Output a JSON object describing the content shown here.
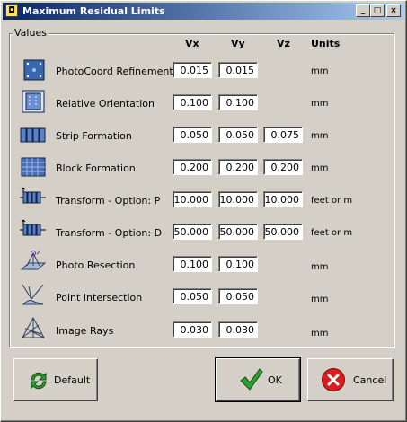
{
  "window": {
    "title": "Maximum Residual Limits"
  },
  "group": {
    "label": "Values"
  },
  "headers": {
    "vx": "Vx",
    "vy": "Vy",
    "vz": "Vz",
    "units": "Units"
  },
  "rows": [
    {
      "label": "PhotoCoord Refinement",
      "icon": "photocoord-icon",
      "vx": "0.015",
      "vy": "0.015",
      "vz": null,
      "unit": "mm"
    },
    {
      "label": "Relative Orientation",
      "icon": "relative-orientation-icon",
      "vx": "0.100",
      "vy": "0.100",
      "vz": null,
      "unit": "mm"
    },
    {
      "label": "Strip Formation",
      "icon": "strip-formation-icon",
      "vx": "0.050",
      "vy": "0.050",
      "vz": "0.075",
      "unit": "mm"
    },
    {
      "label": "Block Formation",
      "icon": "block-formation-icon",
      "vx": "0.200",
      "vy": "0.200",
      "vz": "0.200",
      "unit": "mm"
    },
    {
      "label": "Transform - Option: P",
      "icon": "transform-p-icon",
      "vx": "10.000",
      "vy": "10.000",
      "vz": "10.000",
      "unit": "feet or m"
    },
    {
      "label": "Transform - Option: D",
      "icon": "transform-d-icon",
      "vx": "50.000",
      "vy": "50.000",
      "vz": "50.000",
      "unit": "feet or m"
    },
    {
      "label": "Photo Resection",
      "icon": "photo-resection-icon",
      "vx": "0.100",
      "vy": "0.100",
      "vz": null,
      "unit": "mm"
    },
    {
      "label": "Point Intersection",
      "icon": "point-intersection-icon",
      "vx": "0.050",
      "vy": "0.050",
      "vz": null,
      "unit": "mm"
    },
    {
      "label": "Image Rays",
      "icon": "image-rays-icon",
      "vx": "0.030",
      "vy": "0.030",
      "vz": null,
      "unit": "mm"
    }
  ],
  "buttons": {
    "default_label": "Default",
    "ok_label": "OK",
    "cancel_label": "Cancel"
  },
  "colors": {
    "title_start": "#0a246a",
    "title_end": "#a6caf0",
    "face": "#d4d0c8",
    "ok_check": "#2e9e2e",
    "cancel_red": "#d81e1e"
  }
}
